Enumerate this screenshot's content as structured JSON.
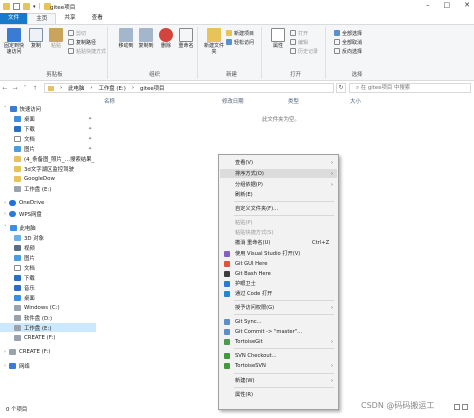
{
  "window": {
    "title": "gitee项目",
    "controls": [
      "–",
      "□",
      "✕"
    ]
  },
  "tabs": [
    {
      "label": "文件"
    },
    {
      "label": "主页"
    },
    {
      "label": "共享"
    },
    {
      "label": "查看"
    }
  ],
  "ribbon": {
    "clipboard": {
      "label": "剪贴板",
      "pin_quick": "固定到快速访问",
      "copy": "复制",
      "paste": "粘贴",
      "cut": "剪切",
      "copy_path": "复制路径",
      "paste_shortcut": "粘贴快捷方式"
    },
    "organize": {
      "label": "组织",
      "move_to": "移动到",
      "copy_to": "复制到",
      "delete": "删除",
      "rename": "重命名"
    },
    "new": {
      "label": "新建",
      "new_folder": "新建文件夹",
      "new_item": "新建项目",
      "easy_access": "轻松访问"
    },
    "open": {
      "label": "打开",
      "properties": "属性",
      "open": "打开",
      "edit": "编辑",
      "history": "历史记录"
    },
    "select": {
      "label": "选择",
      "select_all": "全部选择",
      "select_none": "全部取消",
      "invert": "反向选择"
    }
  },
  "address": {
    "crumbs": [
      "此电脑",
      "工作盘 (E:)",
      "gitee项目"
    ],
    "search_placeholder": "在 gitee项目 中搜索"
  },
  "nav": {
    "items": [
      {
        "label": "快速访问"
      },
      {
        "label": "桌面"
      },
      {
        "label": "下载"
      },
      {
        "label": "文档"
      },
      {
        "label": "图片"
      },
      {
        "label": "(4_条备图_照片_…搜索结果_"
      },
      {
        "label": "3d文字湖区监控驾驶"
      },
      {
        "label": "GoogleDow"
      },
      {
        "label": "工作盘 (E:)"
      },
      {
        "label": "OneDrive"
      },
      {
        "label": "WPS网盘"
      },
      {
        "label": "此电脑"
      },
      {
        "label": "3D 对象"
      },
      {
        "label": "视频"
      },
      {
        "label": "图片"
      },
      {
        "label": "文档"
      },
      {
        "label": "下载"
      },
      {
        "label": "音乐"
      },
      {
        "label": "桌面"
      },
      {
        "label": "Windows (C:)"
      },
      {
        "label": "软件盘 (D:)"
      },
      {
        "label": "工作盘 (E:)"
      },
      {
        "label": "CREATE (F:)"
      },
      {
        "label": "CREATE (F:)"
      },
      {
        "label": "网络"
      }
    ]
  },
  "columns": {
    "name": "名称",
    "date": "修改日期",
    "type": "类型",
    "size": "大小"
  },
  "empty_message": "此文件夹为空。",
  "status": {
    "count": "0 个项目"
  },
  "context_menu": {
    "items": [
      {
        "label": "查看(V)"
      },
      {
        "label": "排序方式(O)"
      },
      {
        "label": "分组依据(P)"
      },
      {
        "label": "刷新(E)"
      },
      {
        "label": "自定义文件夹(F)..."
      },
      {
        "label": "粘贴(P)"
      },
      {
        "label": "粘贴快捷方式(S)"
      },
      {
        "label": "撤消 重命名(U)",
        "shortcut": "Ctrl+Z"
      },
      {
        "label": "使用 Visual Studio 打开(V)"
      },
      {
        "label": "Git GUI Here"
      },
      {
        "label": "Git Bash Here"
      },
      {
        "label": "护眼卫士"
      },
      {
        "label": "通过 Code 打开"
      },
      {
        "label": "授予访问权限(G)"
      },
      {
        "label": "Git Sync..."
      },
      {
        "label": "Git Commit -> \"master\"..."
      },
      {
        "label": "TortoiseGit"
      },
      {
        "label": "SVN Checkout..."
      },
      {
        "label": "TortoiseSVN"
      },
      {
        "label": "新建(W)"
      },
      {
        "label": "属性(R)"
      }
    ]
  },
  "watermark": "CSDN @码码搬运工",
  "colors": {
    "file_tab": "#1979ca",
    "selection": "#cce8ff",
    "menu_bg": "#f2f2f2"
  }
}
